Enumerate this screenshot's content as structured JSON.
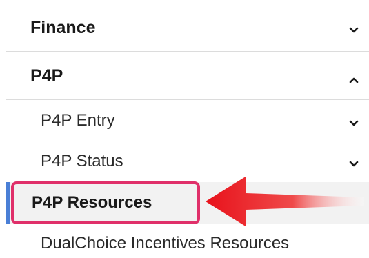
{
  "nav": {
    "finance": {
      "label": "Finance",
      "state": "collapsed"
    },
    "p4p": {
      "label": "P4P",
      "state": "expanded",
      "items": [
        {
          "label": "P4P Entry",
          "state": "collapsed"
        },
        {
          "label": "P4P Status",
          "state": "collapsed"
        },
        {
          "label": "P4P Resources",
          "active": true
        },
        {
          "label": "DualChoice Incentives Resources"
        }
      ]
    }
  },
  "colors": {
    "active_bar": "#4a7fd6",
    "highlight_border": "#e0306a",
    "arrow": "#e8121b",
    "divider": "#dcdcdc"
  },
  "icons": {
    "collapsed": "chevron-down-icon",
    "expanded": "chevron-up-icon"
  }
}
